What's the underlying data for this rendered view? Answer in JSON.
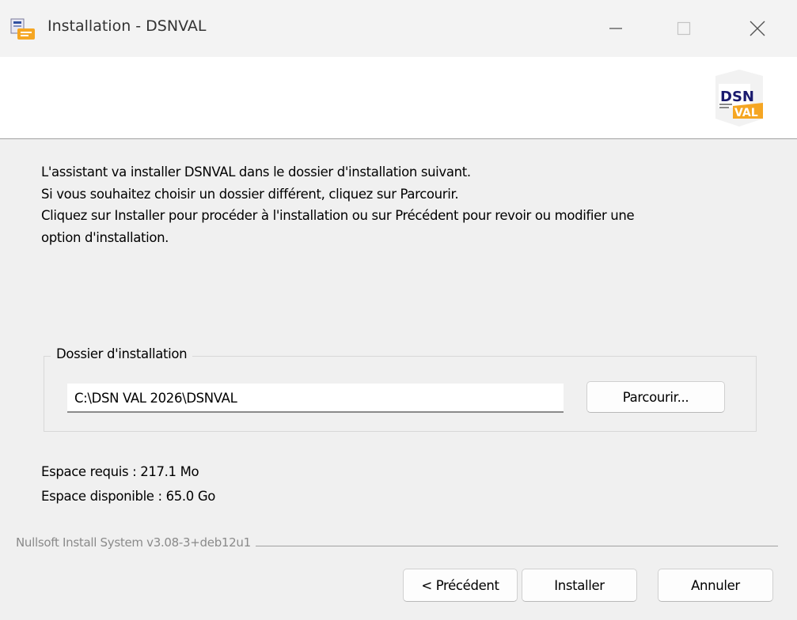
{
  "window": {
    "title": "Installation - DSNVAL",
    "controls": {
      "minimize": "minimize-icon",
      "maximize": "maximize-icon",
      "close": "close-icon"
    }
  },
  "header": {
    "logo": {
      "top": "DSN",
      "bottom": "VAL"
    }
  },
  "intro": {
    "line1": "L'assistant va installer DSNVAL dans le dossier d'installation suivant.",
    "line2": "Si vous souhaitez choisir un dossier différent, cliquez sur Parcourir.",
    "line3": "Cliquez sur Installer pour procéder à l'installation ou sur Précédent pour revoir ou modifier une",
    "line4": "option d'installation."
  },
  "install_folder": {
    "group_label": "Dossier d'installation",
    "path_value": "C:\\DSN VAL 2026\\DSNVAL",
    "browse_label": "Parcourir..."
  },
  "space": {
    "required": "Espace requis : 217.1 Mo",
    "available": "Espace disponible : 65.0 Go"
  },
  "branding": "Nullsoft Install System v3.08-3+deb12u1",
  "buttons": {
    "back": "< Précédent",
    "install": "Installer",
    "cancel": "Annuler"
  },
  "colors": {
    "accent_orange": "#f5a623",
    "window_bg": "#f0f0f0"
  }
}
